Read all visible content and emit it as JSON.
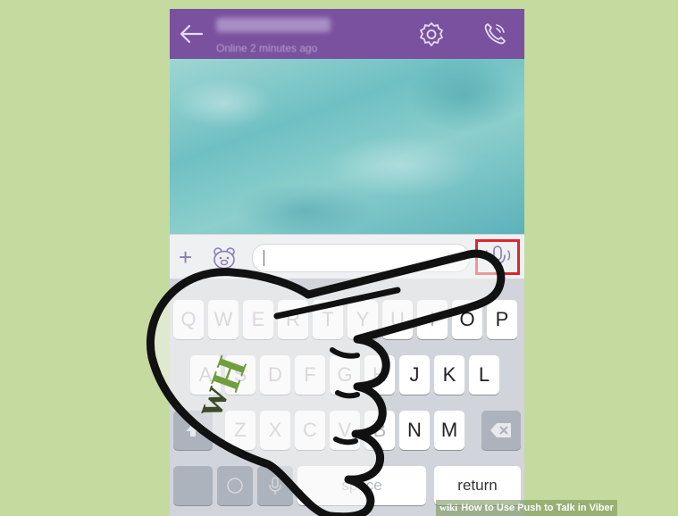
{
  "header": {
    "status": "Online 2 minutes ago",
    "icons": {
      "back": "back-arrow-icon",
      "settings": "gear-icon",
      "call": "phone-call-icon"
    }
  },
  "input_bar": {
    "icons": {
      "plus": "plus-icon",
      "sticker": "sticker-bear-icon",
      "push_to_talk": "microphone-icon"
    },
    "field_value": ""
  },
  "keyboard": {
    "row1": [
      "Q",
      "W",
      "E",
      "R",
      "T",
      "Y",
      "U",
      "I",
      "O",
      "P"
    ],
    "row2": [
      "A",
      "S",
      "D",
      "F",
      "G",
      "H",
      "J",
      "K",
      "L"
    ],
    "row3": [
      "Z",
      "X",
      "C",
      "V",
      "B",
      "N",
      "M"
    ],
    "return_label": "return",
    "space_label": "space"
  },
  "colors": {
    "header": "#7a519f",
    "background": "#c5da9e",
    "highlight": "#e0242a"
  },
  "watermark": {
    "brand": "wiki",
    "title": "How to Use Push to Talk in Viber"
  }
}
